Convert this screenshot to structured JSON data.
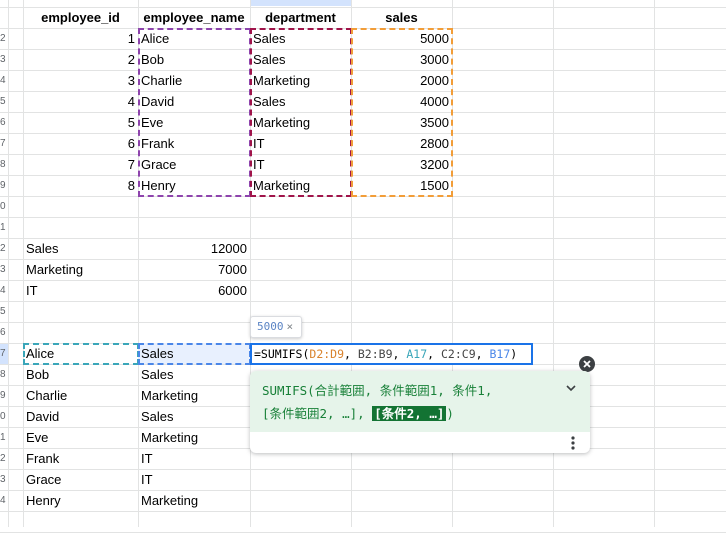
{
  "headers": [
    "employee_id",
    "employee_name",
    "department",
    "sales"
  ],
  "row_numbers_visible": [
    "",
    "2",
    "3",
    "4",
    "5",
    "6",
    "7",
    "8",
    "9",
    "0",
    "1",
    "2",
    "3",
    "4",
    "5",
    "6",
    "7",
    "8",
    "9",
    "0",
    "1",
    "2",
    "3",
    "4"
  ],
  "rows": [
    {
      "id": "1",
      "name": "Alice",
      "dept": "Sales",
      "sales": "5000"
    },
    {
      "id": "2",
      "name": "Bob",
      "dept": "Sales",
      "sales": "3000"
    },
    {
      "id": "3",
      "name": "Charlie",
      "dept": "Marketing",
      "sales": "2000"
    },
    {
      "id": "4",
      "name": "David",
      "dept": "Sales",
      "sales": "4000"
    },
    {
      "id": "5",
      "name": "Eve",
      "dept": "Marketing",
      "sales": "3500"
    },
    {
      "id": "6",
      "name": "Frank",
      "dept": "IT",
      "sales": "2800"
    },
    {
      "id": "7",
      "name": "Grace",
      "dept": "IT",
      "sales": "3200"
    },
    {
      "id": "8",
      "name": "Henry",
      "dept": "Marketing",
      "sales": "1500"
    }
  ],
  "summary": [
    {
      "dept": "Sales",
      "total": "12000"
    },
    {
      "dept": "Marketing",
      "total": "7000"
    },
    {
      "dept": "IT",
      "total": "6000"
    }
  ],
  "lookup": [
    {
      "name": "Alice",
      "dept": "Sales"
    },
    {
      "name": "Bob",
      "dept": "Sales"
    },
    {
      "name": "Charlie",
      "dept": "Marketing"
    },
    {
      "name": "David",
      "dept": "Sales"
    },
    {
      "name": "Eve",
      "dept": "Marketing"
    },
    {
      "name": "Frank",
      "dept": "IT"
    },
    {
      "name": "Grace",
      "dept": "IT"
    },
    {
      "name": "Henry",
      "dept": "Marketing"
    }
  ],
  "formula": {
    "prefix": "=SUMIFS(",
    "arg1": "D2:D9",
    "arg2": "B2:B9",
    "arg3": "A17",
    "arg4": "C2:C9",
    "arg5": "B17",
    "sep": ", ",
    "suffix": ")"
  },
  "preview_value": "5000",
  "preview_close": "×",
  "help": {
    "line1": "SUMIFS(合計範囲, 条件範囲1, 条件1,",
    "line2_plain": "[条件範囲2, …], ",
    "line2_highlight": "[条件2, …]",
    "line2_end": ")"
  },
  "icons": {
    "close": "close-icon",
    "expand": "chevron-down-icon",
    "more": "more-vert-icon"
  },
  "colors": {
    "range_b": "#8e44ad",
    "range_c": "#a0144a",
    "range_d": "#f29d38",
    "range_a17": "#3aa6b9",
    "range_b17": "#4a86e8",
    "help_green": "#188038",
    "help_bg": "#e6f4ea",
    "select_blue": "#1a73e8"
  }
}
